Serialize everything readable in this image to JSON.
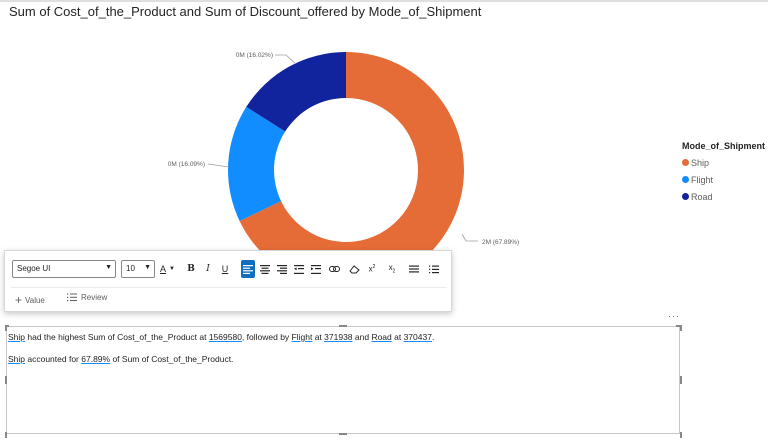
{
  "chart_data": {
    "type": "pie",
    "title": "Sum of Cost_of_the_Product and Sum of Discount_offered by Mode_of_Shipment",
    "legend_title": "Mode_of_Shipment",
    "legend_position": "right",
    "categories": [
      "Ship",
      "Flight",
      "Road"
    ],
    "values": [
      1569580,
      371938,
      370437
    ],
    "data_labels": [
      "2M (67.89%)",
      "0M (16.09%)",
      "0M (16.02%)"
    ],
    "colors": [
      "#e66c37",
      "#118dff",
      "#12239e"
    ],
    "donut": true
  },
  "toolbar": {
    "font": "Segoe UI",
    "size": "10",
    "value_label": "Value",
    "review_label": "Review"
  },
  "narrative": {
    "line1": {
      "p1": "Ship",
      "p2": " had the highest Sum of Cost_of_the_Product at ",
      "p3": "1569580",
      "p4": ", followed by ",
      "p5": "Flight",
      "p6": " at ",
      "p7": "371938",
      "p8": " and ",
      "p9": "Road",
      "p10": " at ",
      "p11": "370437",
      "p12": "."
    },
    "line2": {
      "p1": "Ship",
      "p2": " accounted for ",
      "p3": "67.89%",
      "p4": " of Sum of Cost_of_the_Product."
    }
  },
  "more_options": "···"
}
